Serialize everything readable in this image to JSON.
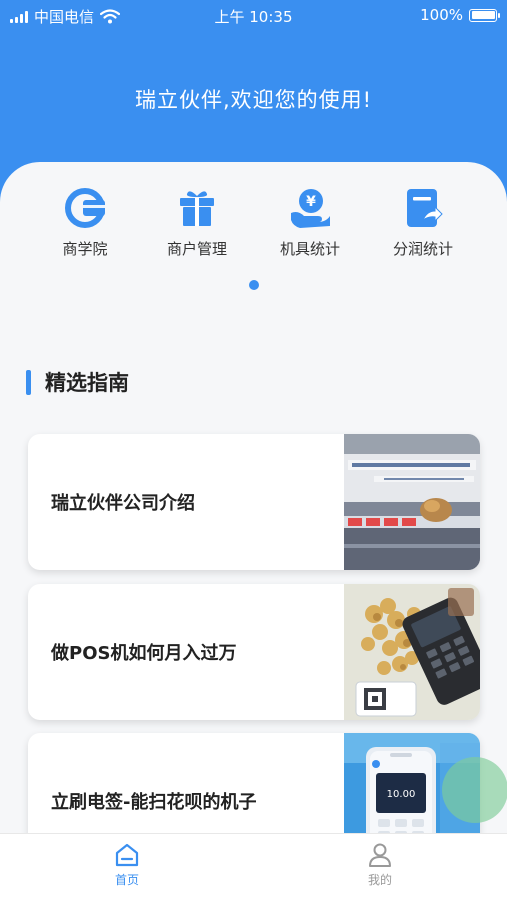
{
  "status_bar": {
    "carrier": "中国电信",
    "time": "上午 10:35",
    "battery": "100%",
    "battery_level": 1.0
  },
  "header": {
    "welcome": "瑞立伙伴,欢迎您的使用!"
  },
  "menu": {
    "items": [
      {
        "label": "商学院",
        "icon": "business-school-icon"
      },
      {
        "label": "商户管理",
        "icon": "gift-box-icon"
      },
      {
        "label": "机具统计",
        "icon": "yen-hand-icon"
      },
      {
        "label": "分润统计",
        "icon": "share-document-icon"
      }
    ],
    "page_indicator": {
      "current": 1,
      "total": 1
    }
  },
  "guide": {
    "title": "精选指南",
    "cards": [
      {
        "title": "瑞立伙伴公司介绍",
        "image": "company-office-photo"
      },
      {
        "title": "做POS机如何月入过万",
        "image": "pos-machine-coins-photo"
      },
      {
        "title": "立刷电签-能扫花呗的机子",
        "image": "pos-terminal-photo"
      }
    ]
  },
  "tabbar": {
    "items": [
      {
        "label": "首页",
        "icon": "home-icon",
        "active": true
      },
      {
        "label": "我的",
        "icon": "user-icon",
        "active": false
      }
    ]
  },
  "colors": {
    "primary": "#3a8ff0",
    "tab_inactive": "#999999",
    "floating_button": "#7ecc98"
  }
}
